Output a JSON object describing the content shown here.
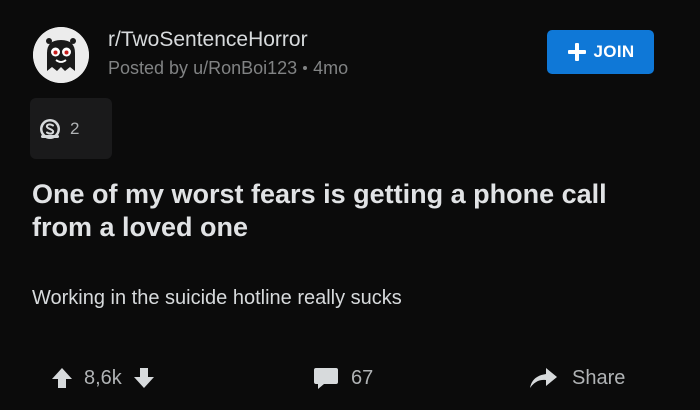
{
  "post": {
    "subreddit": "r/TwoSentenceHorror",
    "posted_by_prefix": "Posted by",
    "author": "u/RonBoi123",
    "age": "4mo",
    "join_label": "JOIN",
    "award_count": "2",
    "title": "One of my worst fears is getting a phone call from a loved one",
    "body": "Working in the suicide hotline really sucks",
    "votes": "8,6k",
    "comments": "67",
    "share_label": "Share"
  },
  "colors": {
    "background": "#0b0b0b",
    "text_primary": "#d7dadc",
    "text_secondary": "#818384",
    "join_button": "#0f78d7",
    "award_box": "#1a1a1b"
  },
  "icons": {
    "avatar": "subreddit-avatar-icon",
    "join": "plus-icon",
    "award": "award-coin-icon",
    "upvote": "upvote-arrow-icon",
    "downvote": "downvote-arrow-icon",
    "comment": "comment-bubble-icon",
    "share": "share-arrow-icon"
  }
}
